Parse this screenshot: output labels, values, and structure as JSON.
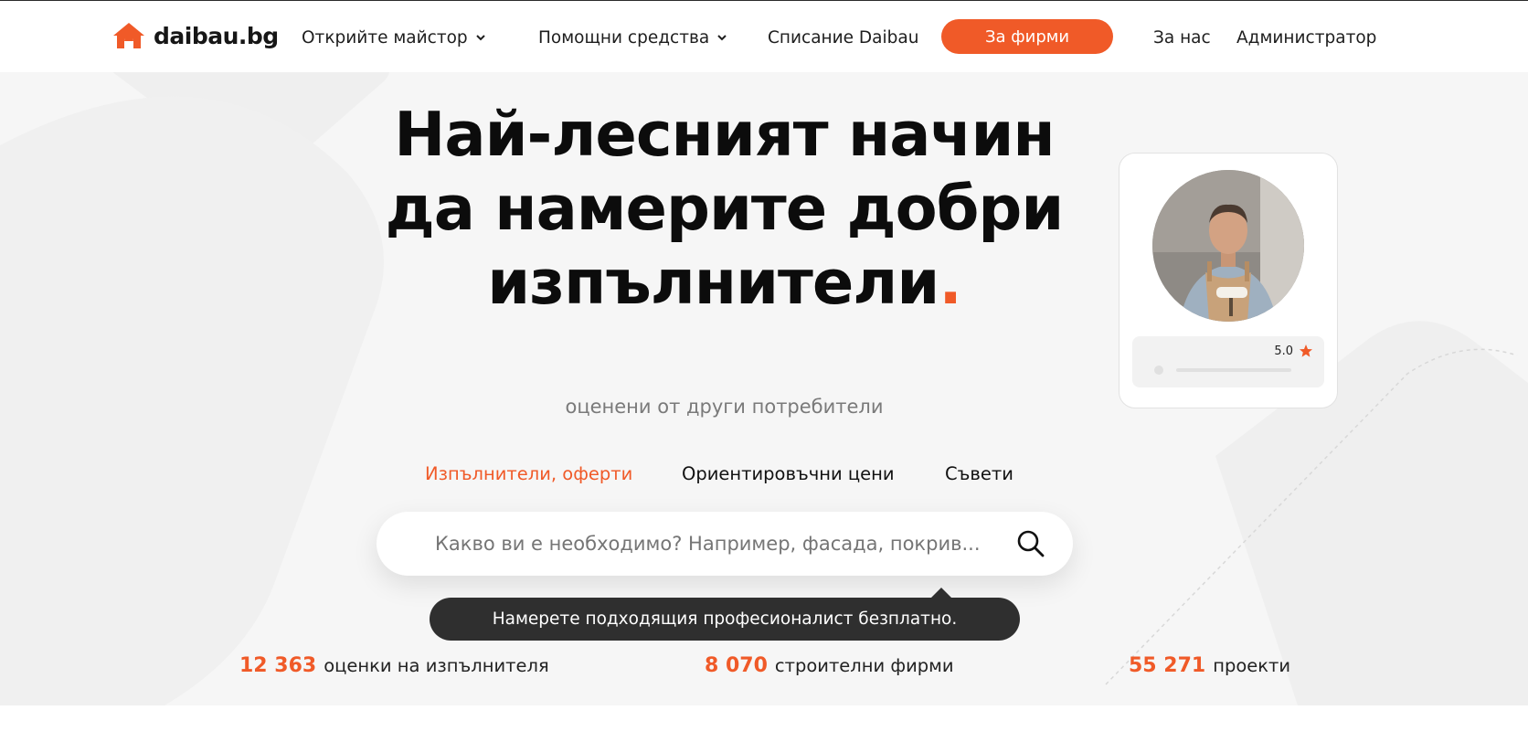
{
  "header": {
    "logo_text": "daibau.bg",
    "nav": {
      "find_master": "Открийте майстор",
      "aids": "Помощни средства",
      "magazine": "Списание Daibau",
      "for_firms": "За фирми",
      "about": "За нас",
      "admin": "Администратор"
    }
  },
  "hero": {
    "headline_main": "Най-лесният начин да намерите добри изпълнители",
    "headline_dot": ".",
    "subtitle": "оценени от други потребители"
  },
  "tabs": [
    {
      "label": "Изпълнители, оферти",
      "active": true
    },
    {
      "label": "Ориентировъчни цени",
      "active": false
    },
    {
      "label": "Съвети",
      "active": false
    }
  ],
  "search": {
    "placeholder": "Какво ви е необходимо? Например, фасада, покрив..."
  },
  "tooltip": {
    "text": "Намерете подходящия професионалист безплатно."
  },
  "stats": [
    {
      "value": "12 363",
      "label": "оценки на изпълнителя"
    },
    {
      "value": "8 070",
      "label": "строителни фирми"
    },
    {
      "value": "55 271",
      "label": "проекти"
    }
  ],
  "card": {
    "rating": "5.0"
  },
  "colors": {
    "accent": "#f05a28",
    "dark": "#2f2f2f",
    "hero_bg": "#f6f6f6"
  }
}
